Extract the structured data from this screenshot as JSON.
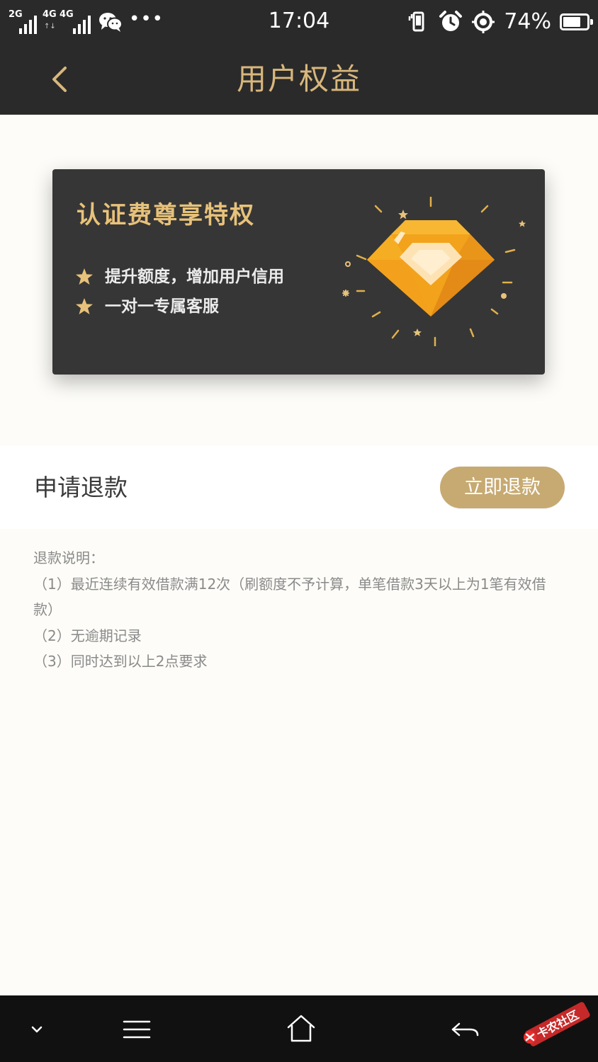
{
  "status_bar": {
    "sim1_network": "2G",
    "sim2_network": "4G",
    "sim2b_network": "4G",
    "more_dots": "•••",
    "time": "17:04",
    "battery_percent_text": "74%",
    "battery_level": 0.74
  },
  "header": {
    "title": "用户权益"
  },
  "privilege_card": {
    "title": "认证费尊享特权",
    "benefits": [
      "提升额度，增加用户信用",
      "一对一专属客服"
    ]
  },
  "refund": {
    "label": "申请退款",
    "button_label": "立即退款"
  },
  "notes": {
    "heading": "退款说明：",
    "items": [
      "（1）最近连续有效借款满12次（刷额度不予计算，单笔借款3天以上为1笔有效借款）",
      "（2）无逾期记录",
      "（3）同时达到以上2点要求"
    ]
  },
  "watermark": {
    "text": "卡农社区"
  },
  "colors": {
    "header_bg": "#2a2a2a",
    "accent_gold": "#d8b77c",
    "card_title_gold": "#e8c27a",
    "card_bg": "#363636",
    "button_bg": "#c7aa72",
    "page_bg": "#fdfcf8",
    "nav_bar_bg": "#111111",
    "diamond_orange": "#f2a21b"
  },
  "icons": {
    "back": "chevron-left-icon",
    "star": "star-icon",
    "diamond": "diamond-icon",
    "nav_down": "chevron-down-icon",
    "nav_menu": "menu-icon",
    "nav_home": "home-icon",
    "nav_back": "back-arrow-icon"
  }
}
